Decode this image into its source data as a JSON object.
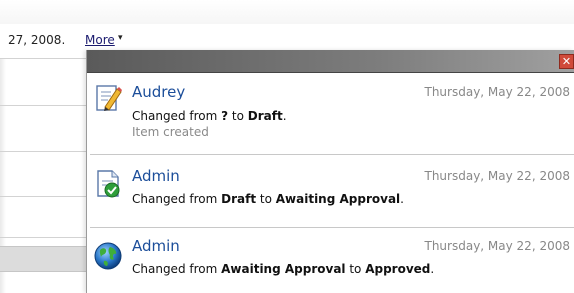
{
  "background": {
    "date_text": "27, 2008.",
    "more_link": "More",
    "more_arrow": "▾"
  },
  "popup": {
    "close_symbol": "✕",
    "entries": [
      {
        "user": "Audrey",
        "date": "Thursday, May 22, 2008",
        "icon": "edit-document-icon",
        "from": "?",
        "to": "Draft",
        "prefix": "Changed from ",
        "middle": " to ",
        "suffix": ".",
        "note": "Item created"
      },
      {
        "user": "Admin",
        "date": "Thursday, May 22, 2008",
        "icon": "approved-document-icon",
        "from": "Draft",
        "to": "Awaiting Approval",
        "prefix": "Changed from ",
        "middle": " to ",
        "suffix": "."
      },
      {
        "user": "Admin",
        "date": "Thursday, May 22, 2008",
        "icon": "globe-icon",
        "from": "Awaiting Approval",
        "to": "Approved",
        "prefix": "Changed from ",
        "middle": " to ",
        "suffix": "."
      }
    ]
  }
}
